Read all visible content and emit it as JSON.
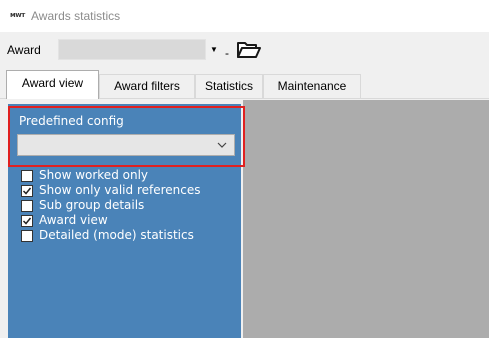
{
  "window": {
    "icon_text": "ᴍᴡᴛ",
    "title": "Awards statistics"
  },
  "award": {
    "label": "Award",
    "selected_value": "",
    "separator": "-",
    "open_icon": "folder-open-icon"
  },
  "tabs": [
    {
      "label": "Award view",
      "active": true
    },
    {
      "label": "Award filters",
      "active": false
    },
    {
      "label": "Statistics",
      "active": false
    },
    {
      "label": "Maintenance",
      "active": false
    }
  ],
  "award_view": {
    "predefined_config": {
      "label": "Predefined config",
      "selected_value": ""
    },
    "options": [
      {
        "label": "Show worked only",
        "checked": false
      },
      {
        "label": "Show only valid references",
        "checked": true
      },
      {
        "label": "Sub group details",
        "checked": false
      },
      {
        "label": "Award view",
        "checked": true
      },
      {
        "label": "Detailed (mode) statistics",
        "checked": false
      }
    ]
  },
  "colors": {
    "panel_blue": "#4a83b8",
    "panel_gray": "#acacac",
    "highlight_red": "#e02020"
  }
}
